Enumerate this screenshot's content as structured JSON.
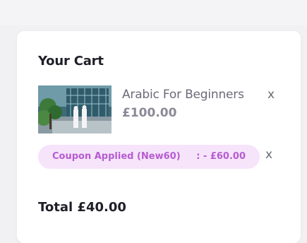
{
  "cart": {
    "title": "Your Cart",
    "item": {
      "name": "Arabic For Beginners",
      "price": "£100.00",
      "remove": "x"
    },
    "coupon": {
      "label": "Coupon Applied (New60)",
      "amount": ": - £60.00",
      "remove": "x"
    },
    "total": "Total £40.00"
  },
  "colors": {
    "accent": "#b55cd0",
    "coupon_bg": "#f6e4fb",
    "text_dark": "#1f1f29"
  }
}
